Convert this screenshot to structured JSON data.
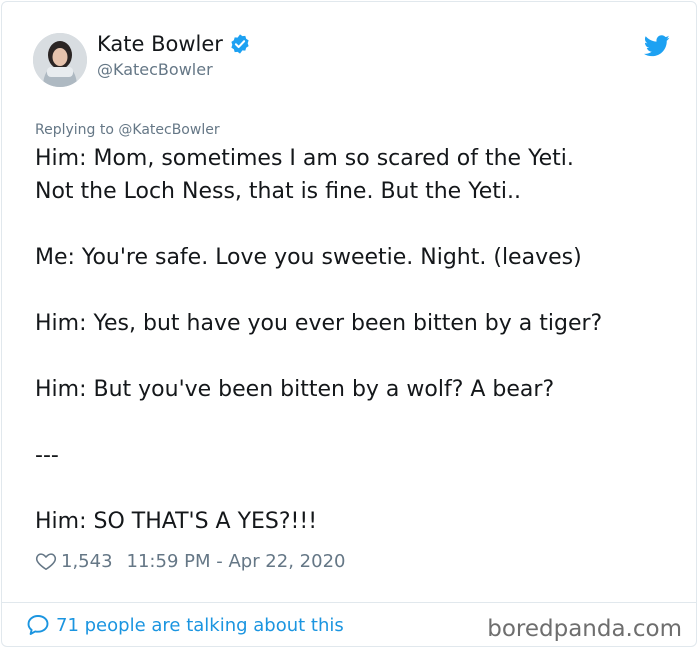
{
  "author": {
    "name": "Kate Bowler",
    "handle": "@KatecBowler"
  },
  "replying_to": {
    "prefix": "Replying to",
    "handle": "@KatecBowler"
  },
  "tweet_lines": [
    "Him: Mom, sometimes I am so scared of the Yeti.",
    "Not the Loch Ness, that is fine. But the Yeti..",
    "",
    "Me: You're safe. Love you sweetie. Night. (leaves)",
    "",
    "Him: Yes, but have you ever been bitten by a tiger?",
    "",
    "Him: But you've been bitten by a wolf? A bear?",
    "",
    "---",
    "",
    "Him: SO THAT'S A YES?!!!"
  ],
  "meta": {
    "likes": "1,543",
    "timestamp": "11:59 PM - Apr 22, 2020"
  },
  "footer": {
    "talking": "71 people are talking about this",
    "watermark": "boredpanda.com"
  },
  "icons": {
    "verified": "verified-badge-icon",
    "brand": "twitter-bird-icon",
    "like": "heart-icon",
    "reply": "speech-bubble-icon"
  },
  "colors": {
    "accent": "#1da1f2",
    "link": "#1b95e0",
    "muted": "#657786"
  }
}
